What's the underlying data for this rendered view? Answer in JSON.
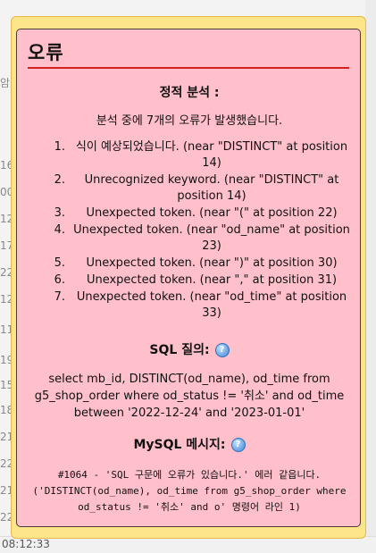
{
  "background": {
    "rows": [
      "",
      "암",
      "",
      "16",
      "00",
      "12",
      "17",
      "22",
      "12",
      "11",
      "19",
      "15",
      "18",
      "21",
      "22",
      "21",
      "22"
    ],
    "time": "08:12:33"
  },
  "dialog": {
    "title": "오류",
    "static_analysis_heading": "정적 분석 :",
    "summary": "분석 중에 7개의 오류가 발생했습니다.",
    "errors": [
      {
        "num": "1.",
        "text": "식이 예상되었습니다. (near \"DISTINCT\" at position 14)"
      },
      {
        "num": "2.",
        "text": "Unrecognized keyword. (near \"DISTINCT\" at position 14)"
      },
      {
        "num": "3.",
        "text": "Unexpected token. (near \"(\" at position 22)"
      },
      {
        "num": "4.",
        "text": "Unexpected token. (near \"od_name\" at position 23)"
      },
      {
        "num": "5.",
        "text": "Unexpected token. (near \")\" at position 30)"
      },
      {
        "num": "6.",
        "text": "Unexpected token. (near \",\" at position 31)"
      },
      {
        "num": "7.",
        "text": "Unexpected token. (near \"od_time\" at position 33)"
      }
    ],
    "sql_heading": "SQL 질의:",
    "sql_query": "select mb_id, DISTINCT(od_name), od_time from g5_shop_order where od_status != '취소' and od_time between '2022-12-24' and '2023-01-01'",
    "mysql_heading": "MySQL 메시지:",
    "mysql_message": "#1064 - 'SQL 구문에 오류가 있습니다.' 에러 같읍니다. ('DISTINCT(od_name), od_time from g5_shop_order where od_status != '취소' and o' 명령어 라인 1)",
    "help_icon": "help-icon"
  }
}
